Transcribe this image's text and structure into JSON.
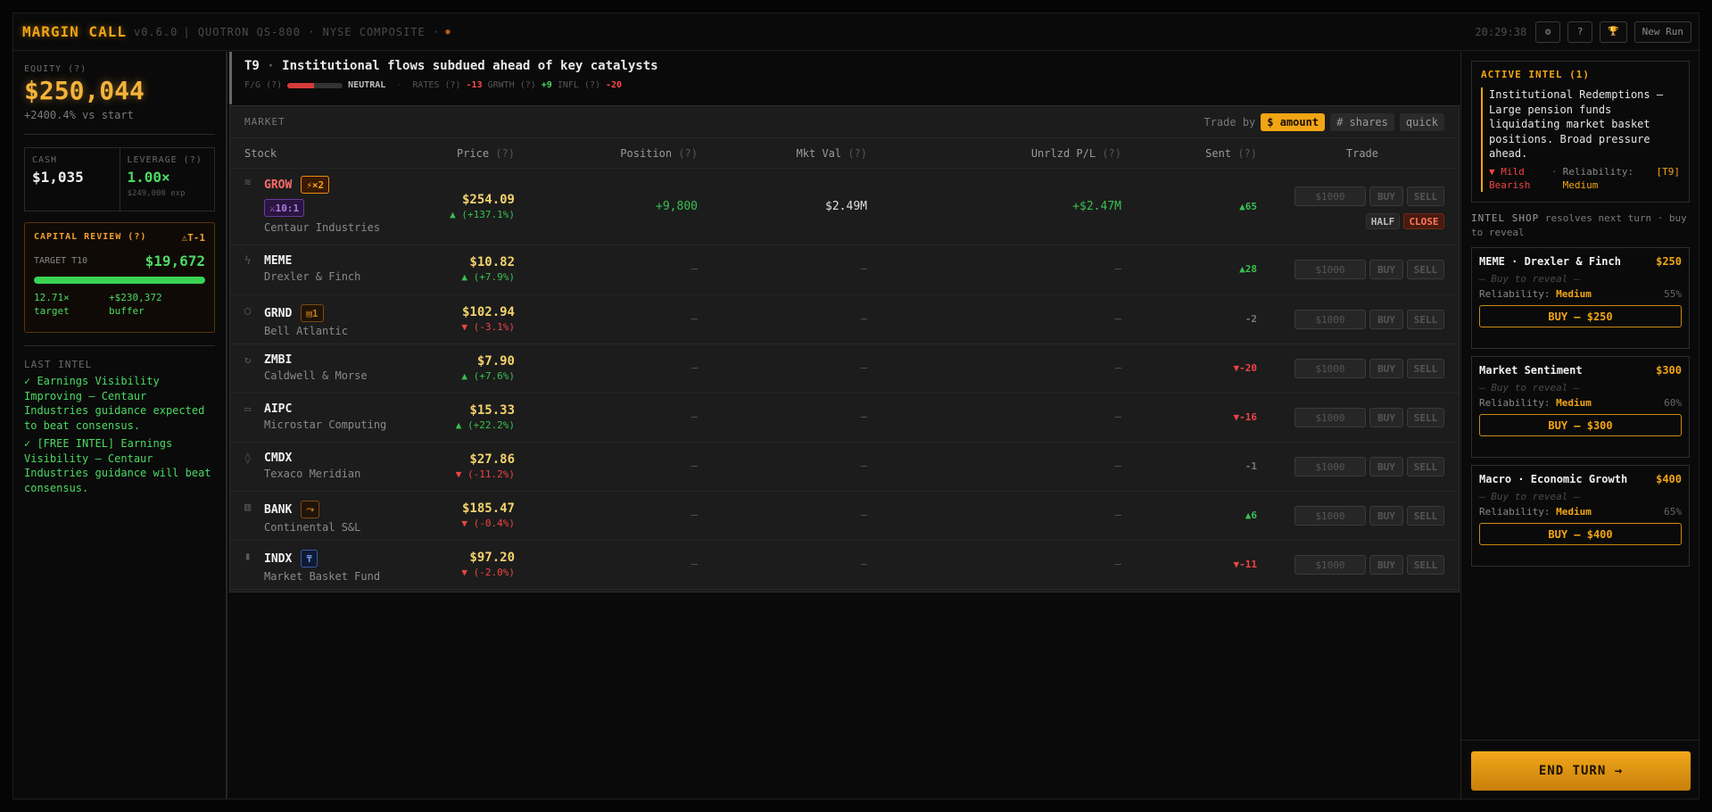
{
  "app": {
    "title": "MARGIN CALL",
    "version": "v0.6.0",
    "terminal": "| QUOTRON QS-800 · NYSE COMPOSITE ·",
    "status_dot": "●",
    "clock": "20:29:38",
    "btn_settings": "⚙",
    "btn_help": "?",
    "btn_trophy": "🏆",
    "btn_new_run": "New Run"
  },
  "left": {
    "equity_label": "EQUITY (?)",
    "equity_value": "$250,044",
    "vs_start": "+2400.4% vs start",
    "cash_label": "CASH",
    "cash_value": "$1,035",
    "leverage_label": "LEVERAGE (?)",
    "leverage_value": "1.00×",
    "leverage_sub": "$249,008 exp",
    "capital_review_label": "CAPITAL REVIEW (?)",
    "capital_review_warn": "⚠T-1",
    "target_label": "TARGET T10",
    "target_value": "$19,672",
    "target_progress": 1.0,
    "stat_multiple": "12.71× target",
    "stat_buffer": "+$230,372 buffer",
    "last_intel_label": "LAST INTEL",
    "last_intel": [
      "✓ Earnings Visibility Improving — Centaur Industries guidance expected to beat consensus.",
      "✓ [FREE INTEL] Earnings Visibility — Centaur Industries guidance will beat consensus."
    ]
  },
  "turn": {
    "number": "T9",
    "headline": "Institutional flows subdued ahead of key catalysts",
    "fg_label": "F/G (?)",
    "fg_state": "NEUTRAL",
    "rates_label": "RATES (?)",
    "rates_value": "-13",
    "growth_label": "GRWTH (?)",
    "growth_value": "+9",
    "infl_label": "INFL (?)",
    "infl_value": "-20"
  },
  "market": {
    "title": "MARKET",
    "trade_by_label": "Trade by",
    "mode_amount": "$ amount",
    "mode_shares": "# shares",
    "mode_quick": "quick",
    "columns": {
      "stock": "Stock",
      "price": "Price",
      "position": "Position",
      "mktval": "Mkt Val",
      "unrlzd": "Unrlzd P/L",
      "sent": "Sent",
      "trade": "Trade",
      "help": "(?)"
    },
    "input_placeholder": "$1000",
    "buy_label": "BUY",
    "sell_label": "SELL",
    "half_label": "HALF",
    "close_label": "CLOSE",
    "dash": "—",
    "stocks": [
      {
        "ticker": "GROW",
        "name": "Centaur Industries",
        "price": "$254.09",
        "change": "▲ (+137.1%)",
        "position": "+9,800",
        "mktval": "$2.49M",
        "pl": "+$2.47M",
        "sent": "▲65",
        "badge1": "⚡×2",
        "badge2": "⚔10:1",
        "icon": "layers-icon",
        "glyph": "≋"
      },
      {
        "ticker": "MEME",
        "name": "Drexler & Finch",
        "price": "$10.82",
        "change": "▲ (+7.9%)",
        "sent": "▲28",
        "icon": "bolt-icon",
        "glyph": "ϟ"
      },
      {
        "ticker": "GRND",
        "name": "Bell Atlantic",
        "price": "$102.94",
        "change": "▼ (-3.1%)",
        "sent": "-2",
        "badge1": "▤1",
        "icon": "shield-icon",
        "glyph": "◯"
      },
      {
        "ticker": "ZMBI",
        "name": "Caldwell & Morse",
        "price": "$7.90",
        "change": "▲ (+7.6%)",
        "sent": "▼-20",
        "icon": "refresh-icon",
        "glyph": "↻"
      },
      {
        "ticker": "AIPC",
        "name": "Microstar Computing",
        "price": "$15.33",
        "change": "▲ (+22.2%)",
        "sent": "▼-16",
        "icon": "monitor-icon",
        "glyph": "▭"
      },
      {
        "ticker": "CMDX",
        "name": "Texaco Meridian",
        "price": "$27.86",
        "change": "▼ (-11.2%)",
        "sent": "-1",
        "icon": "drop-icon",
        "glyph": "◊"
      },
      {
        "ticker": "BANK",
        "name": "Continental S&L",
        "price": "$185.47",
        "change": "▼ (-0.4%)",
        "sent": "▲6",
        "badge1": "⤳",
        "icon": "bank-icon",
        "glyph": "▥"
      },
      {
        "ticker": "INDX",
        "name": "Market Basket Fund",
        "price": "$97.20",
        "change": "▼ (-2.0%)",
        "sent": "▼-11",
        "badge1": "₸",
        "icon": "bars-icon",
        "glyph": "▮"
      }
    ]
  },
  "right": {
    "active_intel_title": "ACTIVE INTEL (1)",
    "active_intel_body": "Institutional Redemptions — Large pension funds liquidating market basket positions. Broad pressure ahead.",
    "active_intel_dir": "▼ Mild Bearish",
    "active_intel_rel_label": "Reliability:",
    "active_intel_rel": "Medium",
    "active_intel_turn": "[T9]",
    "shop_title": "INTEL SHOP",
    "shop_sub": "resolves next turn · buy to reveal",
    "cards": [
      {
        "name": "MEME · Drexler & Finch",
        "price": "$250",
        "blur": "— Buy to reveal —",
        "rel_label": "Reliability:",
        "rel": "Medium",
        "pct": "55%",
        "buy": "BUY — $250"
      },
      {
        "name": "Market Sentiment",
        "price": "$300",
        "blur": "— Buy to reveal —",
        "rel_label": "Reliability:",
        "rel": "Medium",
        "pct": "60%",
        "buy": "BUY — $300"
      },
      {
        "name": "Macro · Economic Growth",
        "price": "$400",
        "blur": "— Buy to reveal —",
        "rel_label": "Reliability:",
        "rel": "Medium",
        "pct": "65%",
        "buy": "BUY — $400"
      }
    ],
    "end_turn": "END TURN →"
  },
  "colors": {
    "accent": "#f2a514",
    "green": "#4cd964",
    "red": "#ef4444"
  }
}
